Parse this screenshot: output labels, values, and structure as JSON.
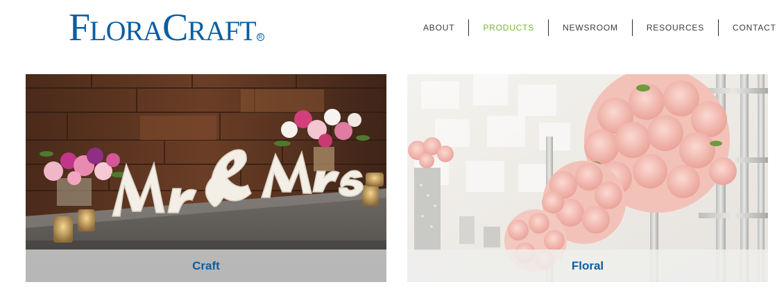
{
  "brand": {
    "logo_first": "F",
    "logo_part1": "LORA",
    "logo_second": "C",
    "logo_part2": "RAFT",
    "registered": "R",
    "color": "#0a5ea3"
  },
  "nav": {
    "items": [
      {
        "label": "ABOUT",
        "active": false
      },
      {
        "label": "PRODUCTS",
        "active": true
      },
      {
        "label": "NEWSROOM",
        "active": false
      },
      {
        "label": "RESOURCES",
        "active": false
      },
      {
        "label": "CONTACT",
        "active": false
      }
    ],
    "active_color": "#76b531"
  },
  "products": [
    {
      "label": "Craft",
      "image": "mr-and-mrs-foam-letters-photo"
    },
    {
      "label": "Floral",
      "image": "pink-rose-pomanders-photo"
    }
  ]
}
